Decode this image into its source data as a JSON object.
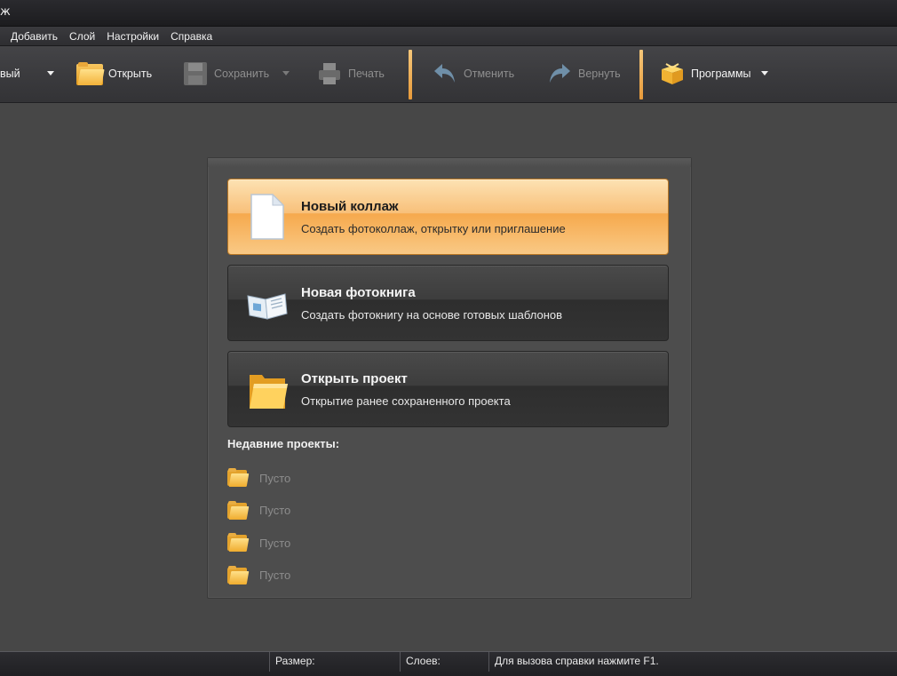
{
  "window": {
    "title": "ж"
  },
  "menu": [
    "Добавить",
    "Слой",
    "Настройки",
    "Справка"
  ],
  "toolbar": {
    "new_label": "вый",
    "open_label": "Открыть",
    "save_label": "Сохранить",
    "print_label": "Печать",
    "undo_label": "Отменить",
    "redo_label": "Вернуть",
    "programs_label": "Программы"
  },
  "start_panel": {
    "cards": [
      {
        "title": "Новый коллаж",
        "subtitle": "Создать фотоколлаж, открытку или приглашение",
        "icon": "blank-page-icon",
        "active": true
      },
      {
        "title": "Новая фотокнига",
        "subtitle": "Создать фотокнигу на основе готовых шаблонов",
        "icon": "open-book-icon",
        "active": false
      },
      {
        "title": "Открыть проект",
        "subtitle": "Открытие ранее сохраненного проекта",
        "icon": "folder-icon",
        "active": false
      }
    ],
    "recent_title": "Недавние проекты:",
    "recent_items": [
      "Пусто",
      "Пусто",
      "Пусто",
      "Пусто"
    ]
  },
  "statusbar": {
    "size_label": "Размер:",
    "layers_label": "Слоев:",
    "help_text": "Для вызова справки нажмите F1."
  },
  "colors": {
    "accent": "#f6a94d",
    "separator": "#e89a3a",
    "background": "#474747"
  }
}
